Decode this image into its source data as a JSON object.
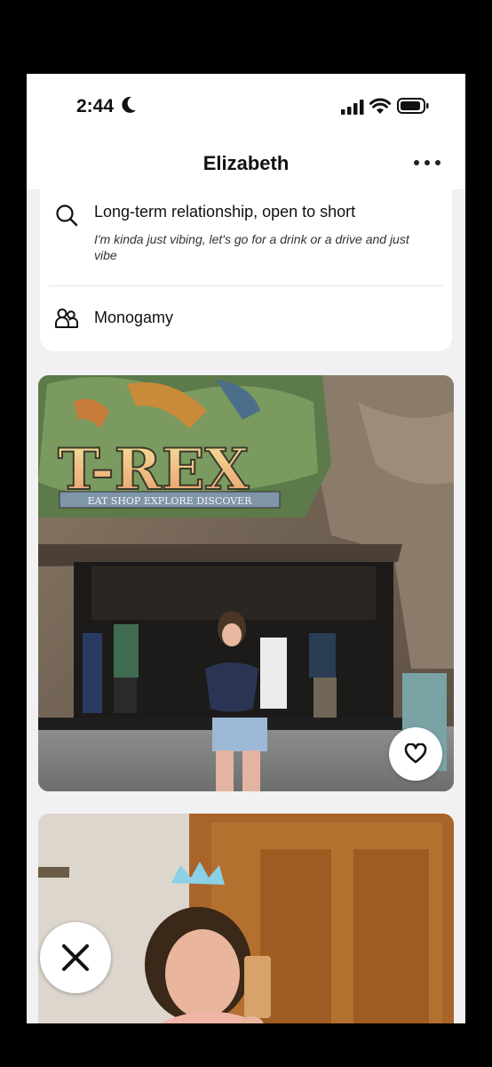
{
  "status_bar": {
    "time": "2:44"
  },
  "header": {
    "title": "Elizabeth"
  },
  "profile_info": {
    "relationship_goal": {
      "label": "Long-term relationship, open to short",
      "description": "I'm kinda just vibing, let's go for a drink or a drive and just vibe"
    },
    "relationship_type": {
      "label": "Monogamy"
    }
  },
  "photo1": {
    "sign_title": "T-REX",
    "sign_subtitle": "EAT SHOP EXPLORE DISCOVER"
  },
  "colors": {
    "screen_bg": "#f1f1f3",
    "card_bg": "#ffffff",
    "text_primary": "#111111"
  }
}
